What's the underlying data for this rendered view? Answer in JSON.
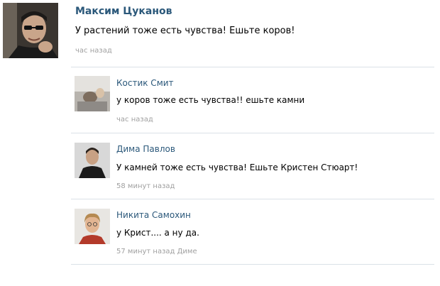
{
  "post": {
    "author": "Максим Цуканов",
    "text": "У растений тоже есть чувства! Ешьте коров!",
    "time": "час назад"
  },
  "comments": [
    {
      "author": "Костик Смит",
      "text": "у коров тоже есть чувства!! ешьте камни",
      "time": "час назад"
    },
    {
      "author": "Дима Павлов",
      "text": "У камней тоже есть чувства! Ешьте Кристен Стюарт!",
      "time": "58 минут назад"
    },
    {
      "author": "Никита Самохин",
      "text": "у Крист.... а ну да.",
      "time": "57 минут назад Диме"
    }
  ],
  "colors": {
    "link": "#2b587a",
    "meta": "#a0a0a0",
    "divider": "#dae1e8"
  }
}
